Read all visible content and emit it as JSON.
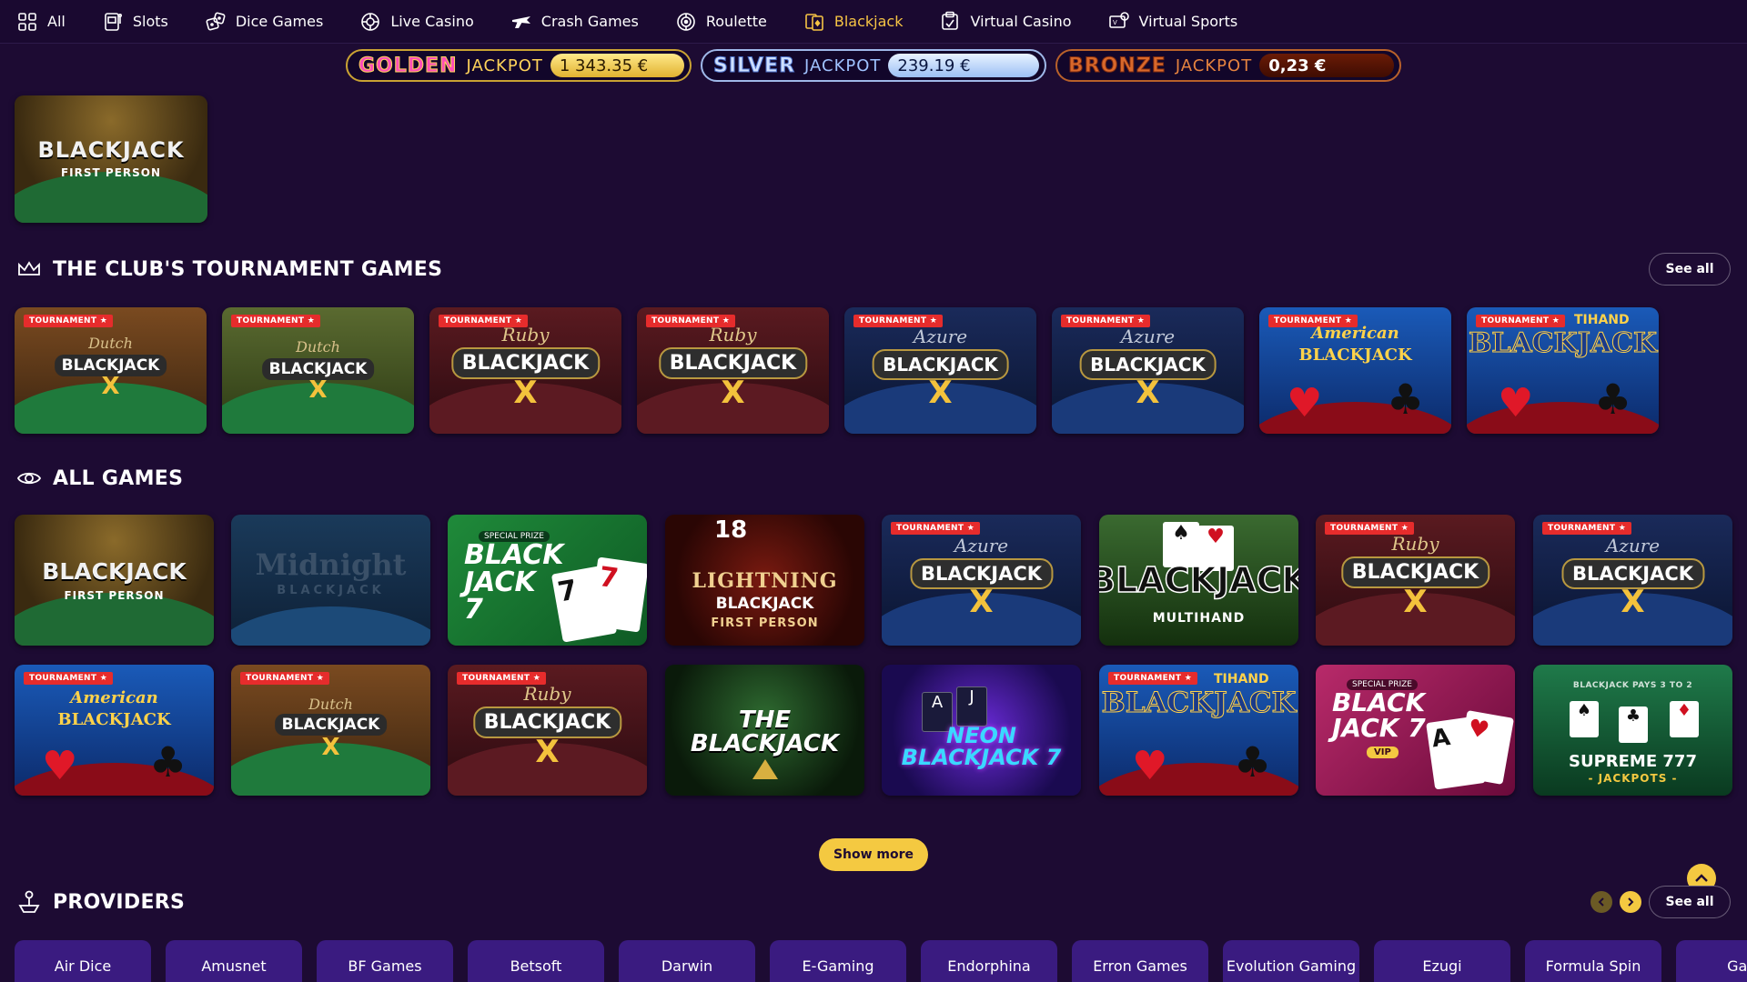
{
  "nav": {
    "items": [
      {
        "label": "All",
        "icon": "grid-icon"
      },
      {
        "label": "Slots",
        "icon": "slot-machine-icon"
      },
      {
        "label": "Dice Games",
        "icon": "dice-icon"
      },
      {
        "label": "Live Casino",
        "icon": "chip-icon"
      },
      {
        "label": "Crash Games",
        "icon": "plane-icon"
      },
      {
        "label": "Roulette",
        "icon": "roulette-icon"
      },
      {
        "label": "Blackjack",
        "icon": "cards-icon"
      },
      {
        "label": "Virtual Casino",
        "icon": "virtual-casino-icon"
      },
      {
        "label": "Virtual Sports",
        "icon": "virtual-sports-icon"
      }
    ],
    "active": "Blackjack",
    "active_color": "#f6c444"
  },
  "jackpots": {
    "golden": {
      "name": "GOLDEN",
      "word": "JACKPOT",
      "amount": "1 343.35 €"
    },
    "silver": {
      "name": "SILVER",
      "word": "JACKPOT",
      "amount": "239.19 €"
    },
    "bronze": {
      "name": "BRONZE",
      "word": "JACKPOT",
      "amount": "0,23 €"
    }
  },
  "featured": {
    "title": "BLACKJACK",
    "subtitle": "FIRST PERSON"
  },
  "tournament": {
    "title": "THE CLUB'S TOURNAMENT GAMES",
    "see_all": "See all",
    "badge": "TOURNAMENT ★",
    "games": [
      {
        "sub": "Dutch",
        "main": "BLACKJACK",
        "mark": "X"
      },
      {
        "sub": "Dutch",
        "main": "BLACKJACK",
        "mark": "X"
      },
      {
        "sub": "Ruby",
        "main": "BLACKJACK",
        "mark": "X"
      },
      {
        "sub": "Ruby",
        "main": "BLACKJACK",
        "mark": "X"
      },
      {
        "sub": "Azure",
        "main": "BLACKJACK",
        "mark": "X"
      },
      {
        "sub": "Azure",
        "main": "BLACKJACK",
        "mark": "X"
      },
      {
        "sub": "American",
        "main": "BLACKJACK",
        "mark": ""
      },
      {
        "sub": "TIHAND",
        "main": "BLACKJACK",
        "mark": ""
      }
    ]
  },
  "all_games": {
    "title": "ALL GAMES",
    "badge": "TOURNAMENT ★",
    "special_badge": "SPECIAL PRIZE",
    "row1": [
      {
        "main": "BLACKJACK",
        "bottom": "FIRST PERSON"
      },
      {
        "main": "Midnight",
        "bottom": "BLACKJACK"
      },
      {
        "main": "BLACK JACK 7",
        "bottom": ""
      },
      {
        "main": "LIGHTNING",
        "sub": "18",
        "mid": "BLACKJACK",
        "bottom": "FIRST PERSON"
      },
      {
        "sub": "Azure",
        "main": "BLACKJACK",
        "mark": "X"
      },
      {
        "main": "BLACKJACK",
        "bottom": "MULTIHAND"
      },
      {
        "sub": "Ruby",
        "main": "BLACKJACK",
        "mark": "X"
      },
      {
        "sub": "Azure",
        "main": "BLACKJACK",
        "mark": "X"
      }
    ],
    "row2": [
      {
        "sub": "American",
        "main": "BLACKJACK"
      },
      {
        "sub": "Dutch",
        "main": "BLACKJACK",
        "mark": "X"
      },
      {
        "sub": "Ruby",
        "main": "BLACKJACK",
        "mark": "X"
      },
      {
        "main": "THE BLACKJACK"
      },
      {
        "main": "NEON BLACKJACK 7"
      },
      {
        "main": "BLACKJACK",
        "sub": "TIHAND"
      },
      {
        "main": "BLACK JACK 7",
        "bottom": "VIP"
      },
      {
        "main": "SUPREME 777",
        "bottom": "- JACKPOTS -",
        "top": "BLACKJACK PAYS 3 TO 2"
      }
    ],
    "show_more": "Show more"
  },
  "providers": {
    "title": "PROVIDERS",
    "see_all": "See all",
    "items": [
      "Air Dice",
      "Amusnet",
      "BF Games",
      "Betsoft",
      "Darwin",
      "E-Gaming",
      "Endorphina",
      "Erron Games",
      "Evolution Gaming",
      "Ezugi",
      "Formula Spin",
      "Gam"
    ]
  }
}
